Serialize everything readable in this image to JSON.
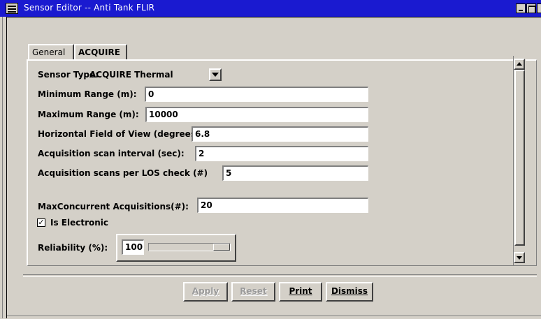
{
  "window": {
    "title": "Sensor Editor -- Anti Tank FLIR"
  },
  "tabs": [
    {
      "label": "General",
      "active": true
    },
    {
      "label": "ACQUIRE",
      "active": false
    }
  ],
  "form": {
    "sensor_type": {
      "label": "Sensor Type:",
      "value": "ACQUIRE Thermal"
    },
    "min_range": {
      "label": "Minimum Range (m):",
      "value": "0"
    },
    "max_range": {
      "label": "Maximum Range (m):",
      "value": "10000"
    },
    "hfov": {
      "label": "Horizontal Field of View (degrees):",
      "value": "6.8"
    },
    "scan_interval": {
      "label": "Acquisition scan interval (sec):",
      "value": "2"
    },
    "scans_per_los": {
      "label": "Acquisition scans per LOS check (#)",
      "value": "5"
    },
    "max_concurrent": {
      "label": "MaxConcurrent Acquisitions(#):",
      "value": "20"
    },
    "is_electronic": {
      "label": "Is Electronic",
      "checked": true
    },
    "reliability": {
      "label": "Reliability (%):",
      "value": "100",
      "level_percent": 100
    }
  },
  "buttons": {
    "apply": {
      "label": "Apply",
      "enabled": false
    },
    "reset": {
      "label": "Reset",
      "enabled": false
    },
    "print": {
      "label": "Print",
      "enabled": true
    },
    "dismiss": {
      "label": "Dismiss",
      "enabled": true
    }
  },
  "colors": {
    "titlebar": "#1a1ad0",
    "background": "#d4d0c8"
  }
}
